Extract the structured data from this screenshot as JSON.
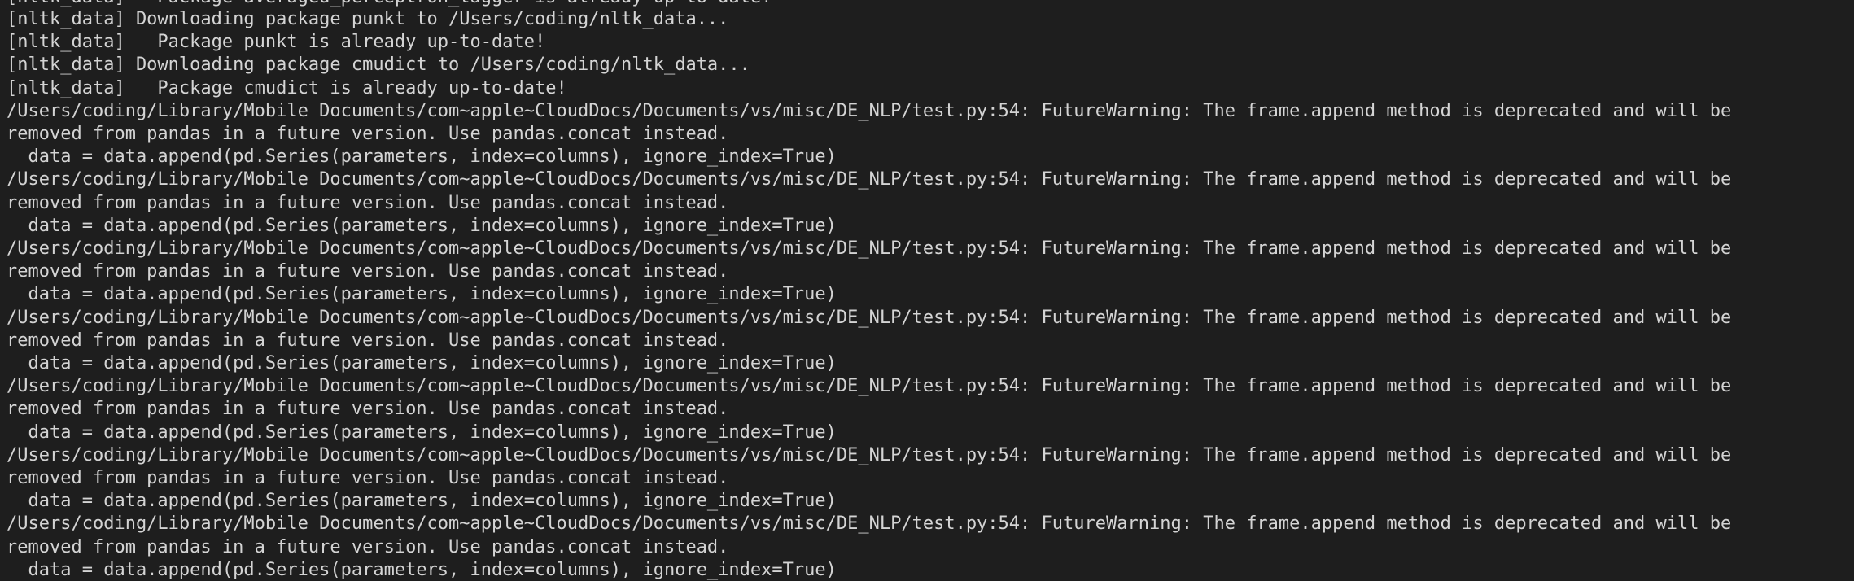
{
  "terminal": {
    "lines": [
      "[nltk_data]   Package averaged_perceptron_tagger is already up-to-date!",
      "[nltk_data] Downloading package punkt to /Users/coding/nltk_data...",
      "[nltk_data]   Package punkt is already up-to-date!",
      "[nltk_data] Downloading package cmudict to /Users/coding/nltk_data...",
      "[nltk_data]   Package cmudict is already up-to-date!",
      "/Users/coding/Library/Mobile Documents/com~apple~CloudDocs/Documents/vs/misc/DE_NLP/test.py:54: FutureWarning: The frame.append method is deprecated and will be",
      "removed from pandas in a future version. Use pandas.concat instead.",
      "  data = data.append(pd.Series(parameters, index=columns), ignore_index=True)",
      "/Users/coding/Library/Mobile Documents/com~apple~CloudDocs/Documents/vs/misc/DE_NLP/test.py:54: FutureWarning: The frame.append method is deprecated and will be",
      "removed from pandas in a future version. Use pandas.concat instead.",
      "  data = data.append(pd.Series(parameters, index=columns), ignore_index=True)",
      "/Users/coding/Library/Mobile Documents/com~apple~CloudDocs/Documents/vs/misc/DE_NLP/test.py:54: FutureWarning: The frame.append method is deprecated and will be",
      "removed from pandas in a future version. Use pandas.concat instead.",
      "  data = data.append(pd.Series(parameters, index=columns), ignore_index=True)",
      "/Users/coding/Library/Mobile Documents/com~apple~CloudDocs/Documents/vs/misc/DE_NLP/test.py:54: FutureWarning: The frame.append method is deprecated and will be",
      "removed from pandas in a future version. Use pandas.concat instead.",
      "  data = data.append(pd.Series(parameters, index=columns), ignore_index=True)",
      "/Users/coding/Library/Mobile Documents/com~apple~CloudDocs/Documents/vs/misc/DE_NLP/test.py:54: FutureWarning: The frame.append method is deprecated and will be",
      "removed from pandas in a future version. Use pandas.concat instead.",
      "  data = data.append(pd.Series(parameters, index=columns), ignore_index=True)",
      "/Users/coding/Library/Mobile Documents/com~apple~CloudDocs/Documents/vs/misc/DE_NLP/test.py:54: FutureWarning: The frame.append method is deprecated and will be",
      "removed from pandas in a future version. Use pandas.concat instead.",
      "  data = data.append(pd.Series(parameters, index=columns), ignore_index=True)",
      "/Users/coding/Library/Mobile Documents/com~apple~CloudDocs/Documents/vs/misc/DE_NLP/test.py:54: FutureWarning: The frame.append method is deprecated and will be",
      "removed from pandas in a future version. Use pandas.concat instead.",
      "  data = data.append(pd.Series(parameters, index=columns), ignore_index=True)"
    ],
    "colors": {
      "background": "#1e1e1e",
      "text": "#d4d4d4"
    }
  }
}
